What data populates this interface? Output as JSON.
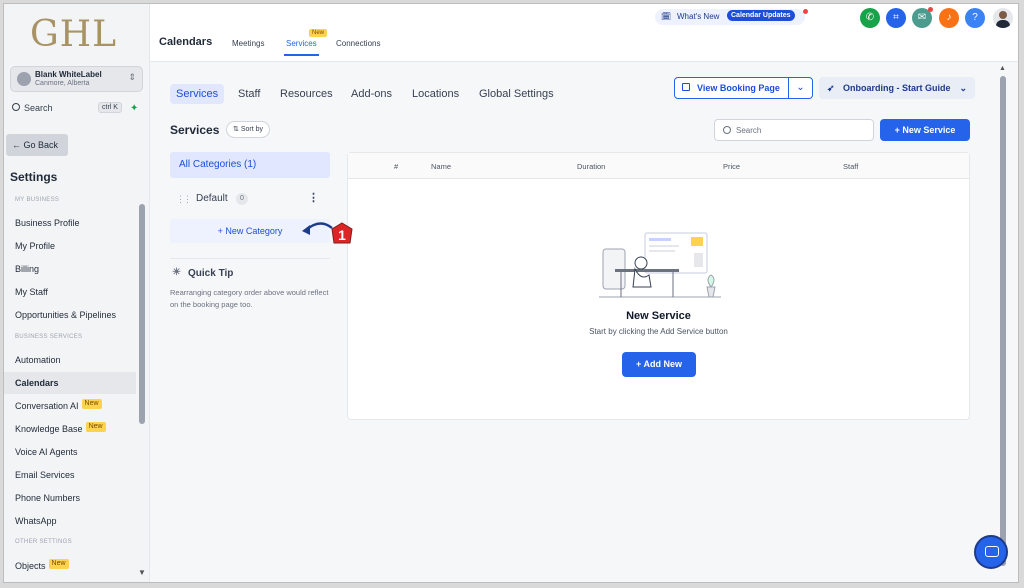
{
  "logo": "GHL",
  "account": {
    "name": "Blank WhiteLabel",
    "location": "Canmore, Alberta"
  },
  "search": {
    "placeholder": "Search",
    "shortcut": "ctrl K"
  },
  "go_back": "Go Back",
  "settings_title": "Settings",
  "sections": {
    "my_business": "MY BUSINESS",
    "business_services": "BUSINESS SERVICES",
    "other_settings": "OTHER SETTINGS"
  },
  "nav_my_business": [
    "Business Profile",
    "My Profile",
    "Billing",
    "My Staff",
    "Opportunities & Pipelines"
  ],
  "nav_business_services": [
    "Automation",
    "Calendars",
    "Conversation AI",
    "Knowledge Base",
    "Voice AI Agents",
    "Email Services",
    "Phone Numbers",
    "WhatsApp"
  ],
  "nav_other": [
    "Objects"
  ],
  "badge_new": "New",
  "top": {
    "title": "Calendars",
    "tabs": [
      "Meetings",
      "Services",
      "Connections"
    ],
    "new_pill": "New",
    "whats_new": "What's New",
    "calendar_updates": "Calendar Updates"
  },
  "subtabs": [
    "Services",
    "Staff",
    "Resources",
    "Add-ons",
    "Locations",
    "Global Settings"
  ],
  "view_booking": "View Booking Page",
  "onboarding": "Onboarding - Start Guide",
  "services_heading": "Services",
  "sort_by": "Sort by",
  "svc_search_placeholder": "Search",
  "new_service": "+ New Service",
  "categories": {
    "all": "All Categories (1)",
    "default_name": "Default",
    "default_count": "0",
    "new_category": "+ New Category"
  },
  "quick_tip": {
    "title": "Quick Tip",
    "text": "Rearranging category order above would reflect on the booking page too."
  },
  "table_headers": [
    "#",
    "Name",
    "Duration",
    "Price",
    "Staff"
  ],
  "empty": {
    "title": "New Service",
    "subtitle": "Start by clicking the Add Service button",
    "button": "+  Add New"
  },
  "marker_number": "1",
  "colors": {
    "accent": "#2563eb",
    "logo": "#a89364",
    "marker": "#dc2626",
    "badge": "#fcd34d"
  }
}
